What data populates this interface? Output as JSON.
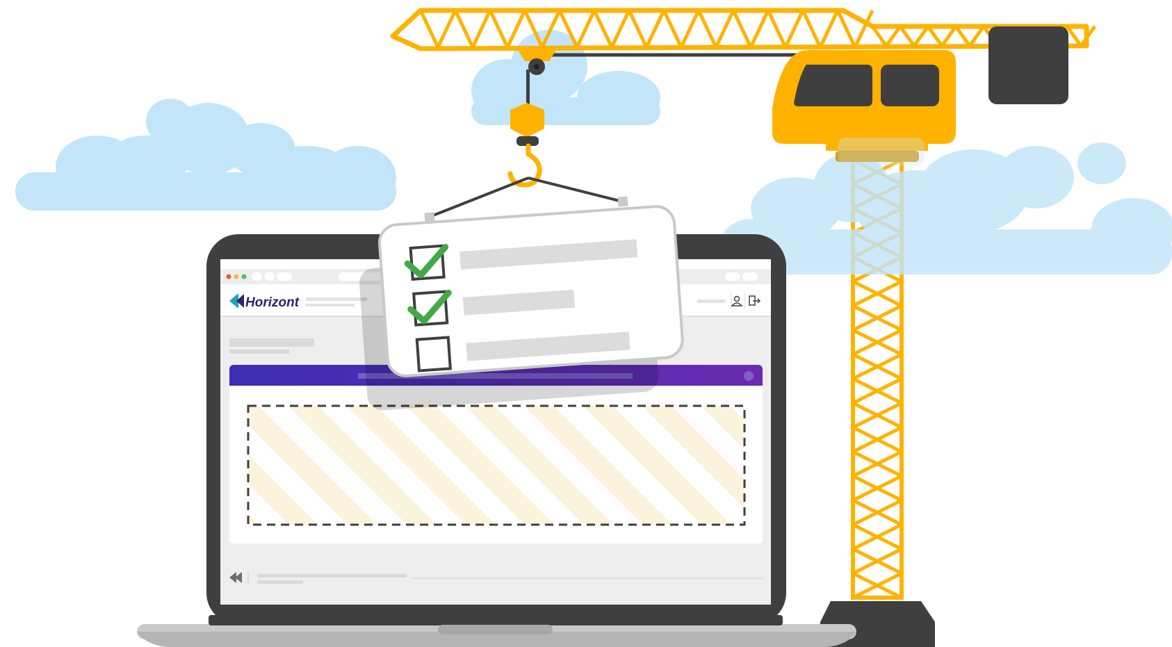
{
  "app": {
    "brand_name": "Horizont"
  },
  "icons": {
    "brand_logo": "horizont-logo-icon",
    "user": "user-icon",
    "logout": "logout-icon",
    "collapse": "double-chevron-left-icon",
    "hook": "crane-hook-icon",
    "checked": "checkmark-icon"
  },
  "checklist": {
    "items": [
      {
        "checked": true
      },
      {
        "checked": true
      },
      {
        "checked": false
      }
    ]
  },
  "colors": {
    "crane_yellow": "#FFB200",
    "crane_dark": "#3F3F3F",
    "cloud_blue": "#C2E5FA",
    "banner_purple_start": "#3D2DB5",
    "banner_purple_end": "#6A2BB0",
    "check_green": "#43A848",
    "brand_navy": "#2A2670",
    "brand_teal": "#1FA3B8",
    "placeholder_stripe": "#FBF3DC"
  }
}
